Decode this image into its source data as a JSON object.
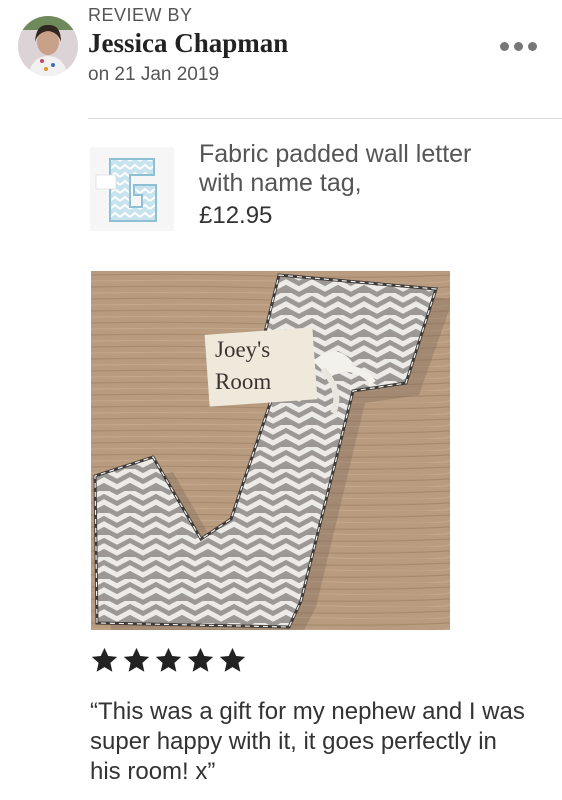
{
  "review": {
    "header_label": "REVIEW BY",
    "reviewer_name": "Jessica Chapman",
    "date": "on 21 Jan 2019",
    "rating": 5,
    "text": "“This was a gift for my nephew and I was super happy with it, it goes perfectly in his room! x”"
  },
  "product": {
    "title": "Fabric padded wall letter with name tag,",
    "price": "£12.95"
  },
  "photo": {
    "tag_line1": "Joey's",
    "tag_line2": "Room"
  },
  "icons": {
    "more": "more-options-icon",
    "star": "star-icon"
  },
  "colors": {
    "star": "#222222",
    "wood": "#b89a7d",
    "fabric_grey": "#9d9a97",
    "thumb_blue": "#8fbfd2"
  }
}
